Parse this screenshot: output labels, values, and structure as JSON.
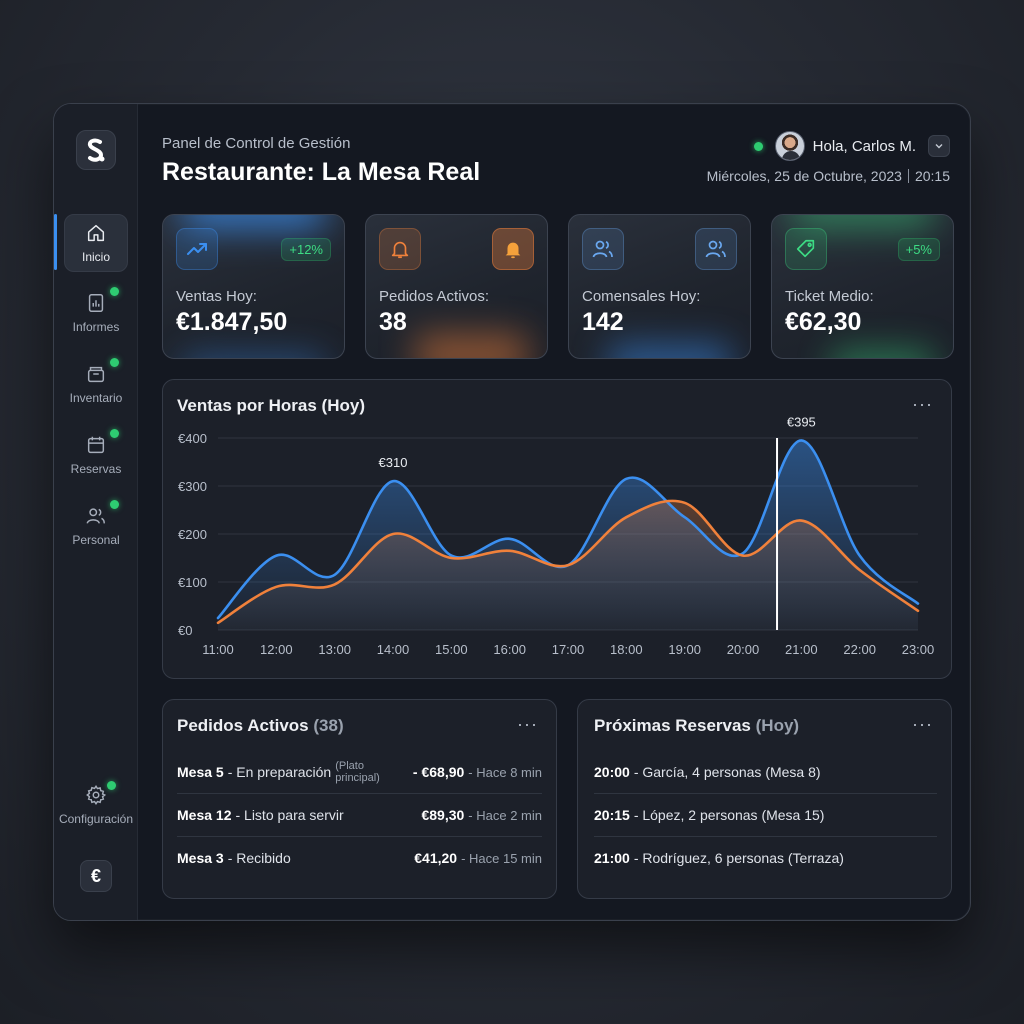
{
  "header": {
    "subtitle": "Panel de Control de Gestión",
    "title": "Restaurante: La Mesa Real",
    "greeting": "Hola, Carlos M.",
    "date": "Miércoles, 25 de Octubre, 2023",
    "time": "20:15"
  },
  "sidebar": {
    "items": [
      {
        "label": "Inicio",
        "icon": "home-icon",
        "active": true
      },
      {
        "label": "Informes",
        "icon": "report-icon"
      },
      {
        "label": "Inventario",
        "icon": "inventory-icon"
      },
      {
        "label": "Reservas",
        "icon": "calendar-icon"
      },
      {
        "label": "Personal",
        "icon": "people-icon"
      }
    ],
    "settings_label": "Configuración",
    "currency_symbol": "€"
  },
  "kpis": [
    {
      "label": "Ventas Hoy:",
      "value": "€1.847,50",
      "badge": "+12%",
      "icon": "trend-up-icon",
      "color": "#3b8ff0"
    },
    {
      "label": "Pedidos Activos:",
      "value": "38",
      "icon": "bell-icon",
      "color": "#f0813b"
    },
    {
      "label": "Comensales Hoy:",
      "value": "142",
      "icon": "people-icon",
      "color": "#6aa8f0"
    },
    {
      "label": "Ticket Medio:",
      "value": "€62,30",
      "badge": "+5%",
      "icon": "tag-icon",
      "color": "#3ddc84"
    }
  ],
  "chart_panel": {
    "title": "Ventas por Horas (Hoy)",
    "more": "···"
  },
  "chart_data": {
    "type": "area",
    "x": [
      "11:00",
      "12:00",
      "13:00",
      "14:00",
      "15:00",
      "16:00",
      "17:00",
      "18:00",
      "19:00",
      "20:00",
      "21:00",
      "22:00",
      "23:00"
    ],
    "yticks": [
      "€0",
      "€100",
      "€200",
      "€300",
      "€400"
    ],
    "ylim": [
      0,
      400
    ],
    "series": [
      {
        "color": "#3b8ff0",
        "values": [
          25,
          155,
          115,
          310,
          155,
          190,
          135,
          315,
          235,
          160,
          395,
          155,
          55
        ]
      },
      {
        "color": "#f0813b",
        "values": [
          15,
          90,
          95,
          200,
          150,
          165,
          135,
          235,
          265,
          155,
          228,
          125,
          40
        ]
      }
    ],
    "annotations": [
      {
        "x": "14:00",
        "label": "€310"
      },
      {
        "x": "21:00",
        "label": "€395"
      }
    ],
    "cursor_x": "20:35",
    "grid": true
  },
  "orders_panel": {
    "title": "Pedidos Activos",
    "count": "(38)",
    "more": "···",
    "rows": [
      {
        "table": "Mesa 5",
        "status": " - En preparación",
        "note": "(Plato principal)",
        "price": "- €68,90",
        "ago": " - Hace 8 min"
      },
      {
        "table": "Mesa 12",
        "status": " - Listo para servir",
        "note": "",
        "price": "€89,30",
        "ago": " - Hace 2 min"
      },
      {
        "table": "Mesa 3",
        "status": " - Recibido",
        "note": "",
        "price": "€41,20",
        "ago": " - Hace 15 min"
      }
    ]
  },
  "reservations_panel": {
    "title": "Próximas Reservas",
    "suffix": "(Hoy)",
    "more": "···",
    "rows": [
      {
        "time": "20:00",
        "text": " - García, 4 personas (Mesa 8)"
      },
      {
        "time": "20:15",
        "text": " - López, 2 personas (Mesa 15)"
      },
      {
        "time": "21:00",
        "text": " - Rodríguez, 6 personas (Terraza)"
      }
    ]
  }
}
